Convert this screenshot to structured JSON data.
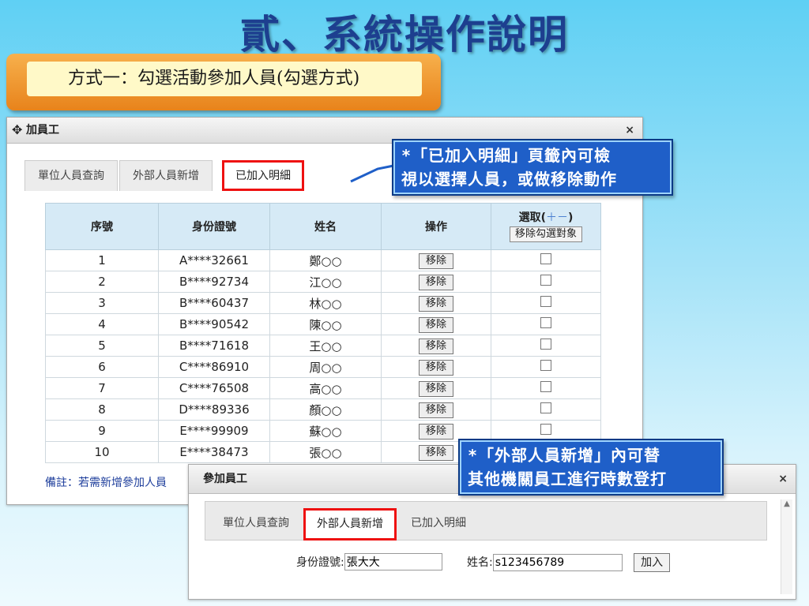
{
  "slide_title": "貳、系統操作說明",
  "method_label": "方式一：勾選活動參加人員(勾選方式)",
  "window1": {
    "title": "加員工",
    "close": "×",
    "tabs": [
      "單位人員查詢",
      "外部人員新增",
      "已加入明細"
    ],
    "columns": [
      "序號",
      "身份證號",
      "姓名",
      "操作"
    ],
    "select_header": "選取(",
    "select_plusminus": "＋－",
    "select_close": ")",
    "remove_selected_label": "移除勾選對象",
    "remove_label": "移除",
    "rows": [
      {
        "no": "1",
        "id": "A****32661",
        "name": "鄭○○"
      },
      {
        "no": "2",
        "id": "B****92734",
        "name": "江○○"
      },
      {
        "no": "3",
        "id": "B****60437",
        "name": "林○○"
      },
      {
        "no": "4",
        "id": "B****90542",
        "name": "陳○○"
      },
      {
        "no": "5",
        "id": "B****71618",
        "name": "王○○"
      },
      {
        "no": "6",
        "id": "C****86910",
        "name": "周○○"
      },
      {
        "no": "7",
        "id": "C****76508",
        "name": "高○○"
      },
      {
        "no": "8",
        "id": "D****89336",
        "name": "顏○○"
      },
      {
        "no": "9",
        "id": "E****99909",
        "name": "蘇○○"
      },
      {
        "no": "10",
        "id": "E****38473",
        "name": "張○○"
      }
    ],
    "note": "備註：若需新增參加人員"
  },
  "callout1": {
    "line1": "*「已加入明細」頁籤內可檢",
    "line2": "視以選擇人員，或做移除動作"
  },
  "callout2": {
    "line1": "*「外部人員新增」內可替",
    "line2": "其他機關員工進行時數登打"
  },
  "window2": {
    "title": "參加員工",
    "close": "×",
    "tabs": [
      "單位人員查詢",
      "外部人員新增",
      "已加入明細"
    ],
    "id_label": "身份證號:",
    "id_value": "張大大",
    "name_label": "姓名:",
    "name_value": "s123456789",
    "add_label": "加入"
  }
}
